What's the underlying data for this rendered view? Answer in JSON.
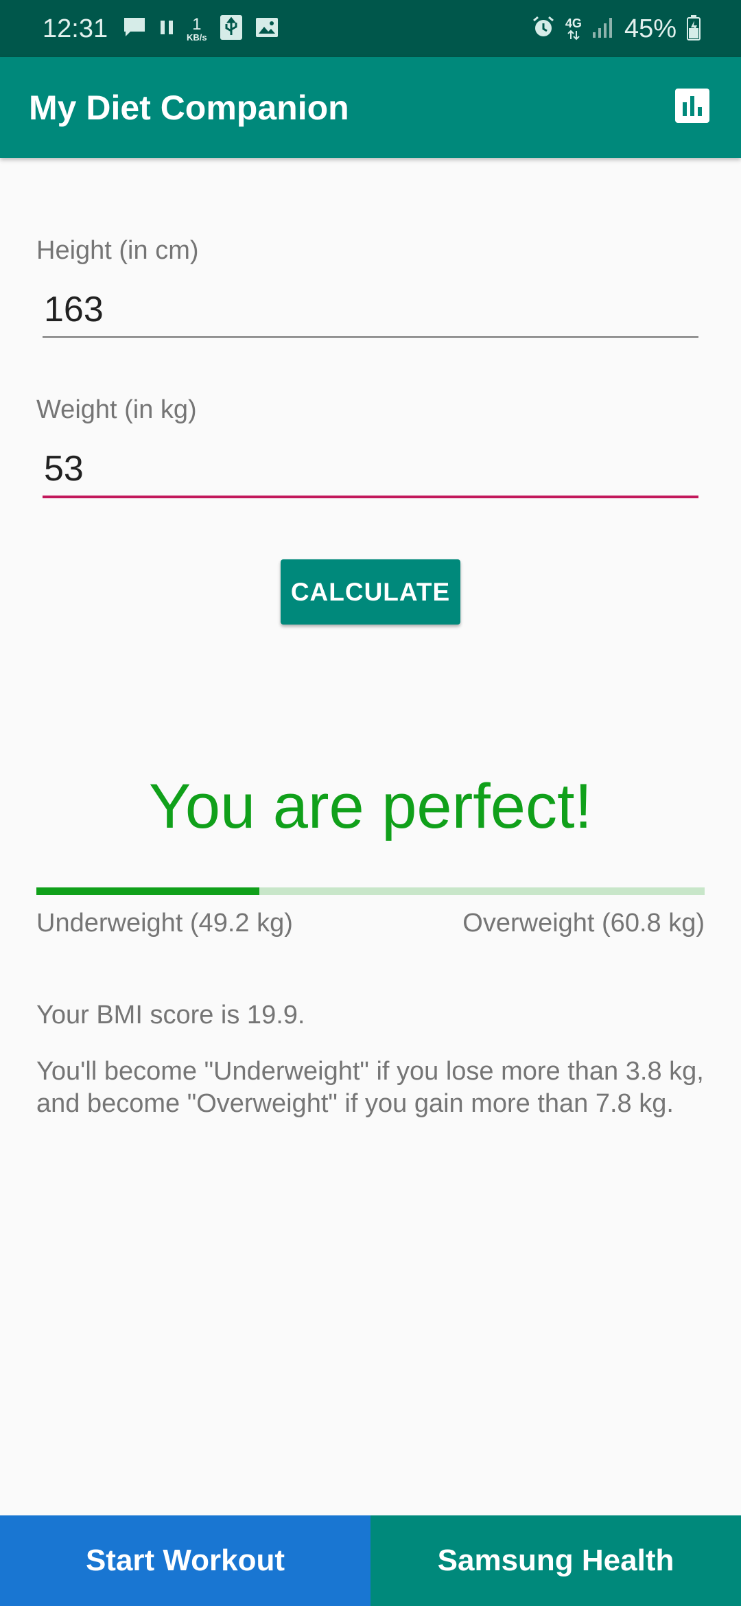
{
  "status_bar": {
    "time": "12:31",
    "speed_value": "1",
    "speed_unit": "KB/s",
    "network": "4G",
    "battery": "45%",
    "left_icons": [
      "message-icon",
      "pause-icon",
      "usb-icon",
      "image-icon"
    ],
    "right_icons": [
      "alarm-icon",
      "4g-data-icon",
      "signal-icon",
      "battery-charging-icon"
    ]
  },
  "app_bar": {
    "title": "My Diet Companion",
    "action_icon": "bar-chart-icon"
  },
  "form": {
    "height_label": "Height (in cm)",
    "height_value": "163",
    "weight_label": "Weight (in kg)",
    "weight_value": "53",
    "calculate_label": "CALCULATE"
  },
  "result": {
    "title": "You are perfect!",
    "progress_fraction": 0.334,
    "underweight_label": "Underweight (49.2 kg)",
    "overweight_label": "Overweight (60.8 kg)",
    "bmi_text": "Your BMI score is 19.9.",
    "advice_text": "You'll become \"Underweight\" if you lose more than 3.8 kg, and become \"Overweight\" if you gain more than 7.8 kg."
  },
  "bottom": {
    "workout_label": "Start Workout",
    "health_label": "Samsung Health"
  },
  "colors": {
    "primary": "#00897b",
    "primary_dark": "#00574b",
    "accent": "#c2185b",
    "success": "#10a01a",
    "workout_blue": "#1976d2"
  }
}
